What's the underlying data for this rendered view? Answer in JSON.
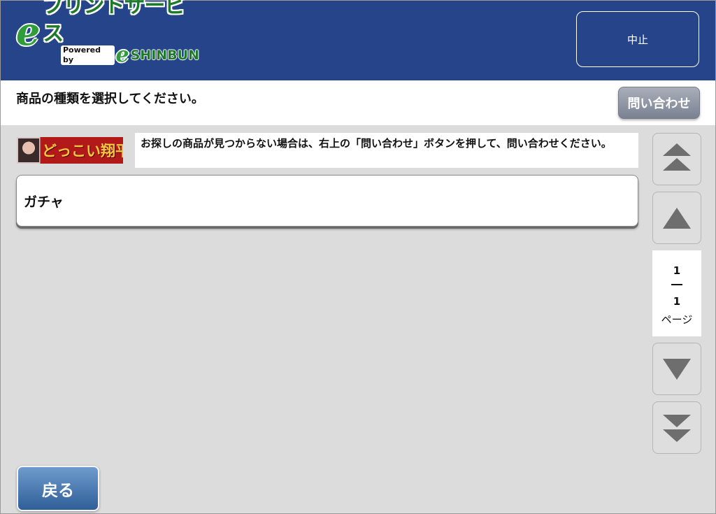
{
  "header": {
    "logo": {
      "main_text": "プリントサービス",
      "powered_by": "Powered by",
      "brand": "SHINBUN"
    },
    "cancel_label": "中止"
  },
  "instruction_bar": {
    "text": "商品の種類を選択してください。",
    "contact_label": "問い合わせ"
  },
  "banner": {
    "text": "どっこい翔平"
  },
  "notice": {
    "text": "お探しの商品が見つからない場合は、右上の「問い合わせ」ボタンを押して、問い合わせください。"
  },
  "items": [
    {
      "label": "ガチャ"
    }
  ],
  "pager": {
    "current": "1",
    "total": "1",
    "label": "ページ",
    "icons": [
      "double-up-arrow-icon",
      "up-arrow-icon",
      "down-arrow-icon",
      "double-down-arrow-icon"
    ]
  },
  "footer": {
    "back_label": "戻る"
  },
  "colors": {
    "header_bg": "#26448a",
    "page_bg": "#dcdcdc",
    "back_button": "#3f6fa8",
    "logo_green": "#2f9e3a"
  }
}
